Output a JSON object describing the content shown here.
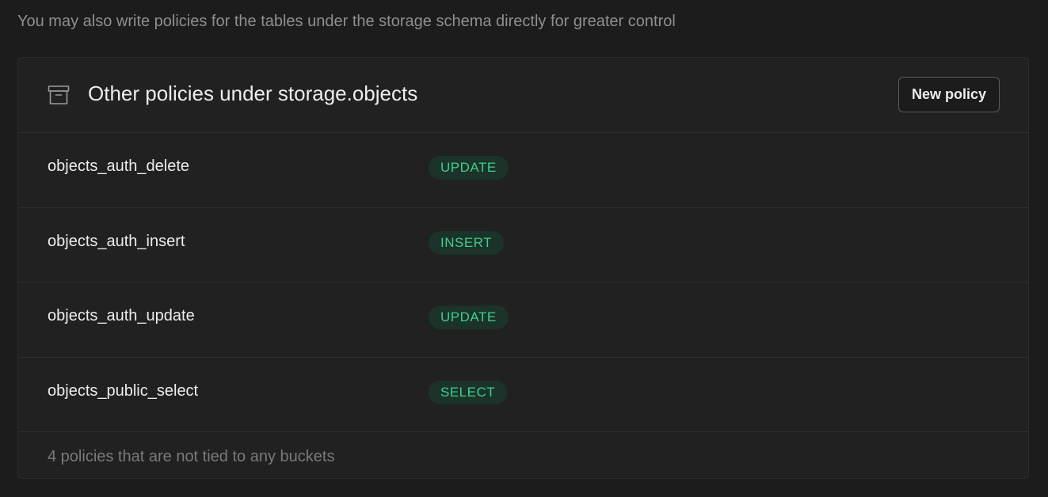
{
  "intro_text": "You may also write policies for the tables under the storage schema directly for greater control",
  "card": {
    "icon": "archive-icon",
    "title": "Other policies under storage.objects",
    "new_policy_label": "New policy",
    "policies": [
      {
        "name": "objects_auth_delete",
        "command": "UPDATE"
      },
      {
        "name": "objects_auth_insert",
        "command": "INSERT"
      },
      {
        "name": "objects_auth_update",
        "command": "UPDATE"
      },
      {
        "name": "objects_public_select",
        "command": "SELECT"
      }
    ],
    "footer": "4 policies that are not tied to any buckets"
  },
  "colors": {
    "background": "#1c1c1c",
    "card": "#212121",
    "badge_text": "#3ecf8e",
    "badge_bg": "#1b3329"
  }
}
